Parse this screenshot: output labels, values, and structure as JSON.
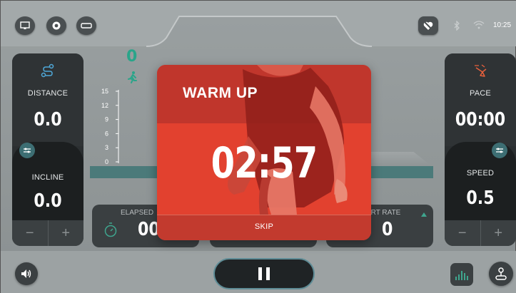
{
  "status_bar": {
    "time": "10:25"
  },
  "top_icons": [
    "screen-cast-icon",
    "ring-icon",
    "hdmi-icon"
  ],
  "left_panel": {
    "distance_label": "DISTANCE",
    "distance_value": "0.0",
    "incline_label": "INCLINE",
    "incline_value": "0.0",
    "minus": "−",
    "plus": "+"
  },
  "right_panel": {
    "pace_label": "PACE",
    "pace_value": "00:00",
    "speed_label": "SPEED",
    "speed_value": "0.5",
    "minus": "−",
    "plus": "+"
  },
  "chart": {
    "current_value": "0",
    "y_ticks": [
      "15",
      "12",
      "9",
      "6",
      "3",
      "0"
    ]
  },
  "tiles": {
    "elapsed_label": "ELAPSED",
    "elapsed_value": "00:",
    "heart_rate_label": "ART RATE",
    "heart_rate_value": "0"
  },
  "modal": {
    "title": "WARM UP",
    "timer": "02:57",
    "skip_label": "SKIP"
  },
  "colors": {
    "modal_red": "#df3c2f",
    "accent_teal": "#5e8c96",
    "panel_dark": "#2b2f31"
  }
}
